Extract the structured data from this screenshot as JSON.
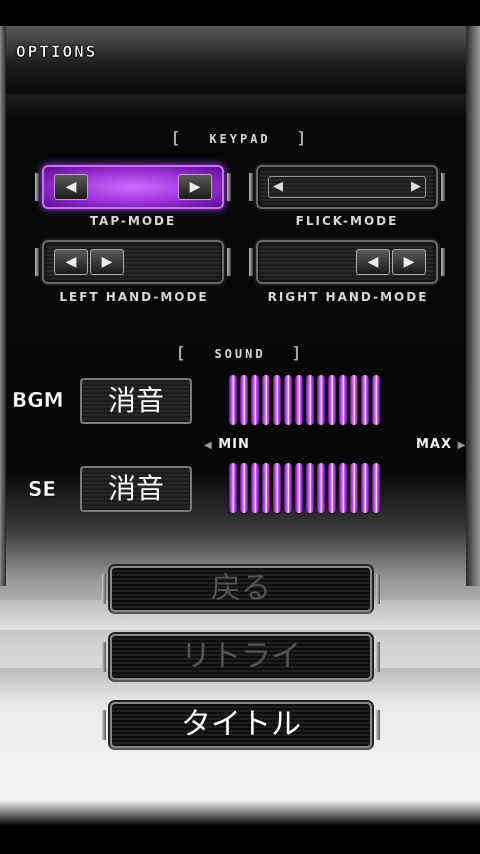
{
  "header": {
    "title": "OPTIONS"
  },
  "keypad": {
    "section_label": "KEYPAD",
    "bracket_open": "[",
    "bracket_close": "]",
    "modes": [
      {
        "label": "TAP-MODE",
        "selected": true
      },
      {
        "label": "FLICK-MODE",
        "selected": false
      },
      {
        "label": "LEFT HAND-MODE",
        "selected": false
      },
      {
        "label": "RIGHT HAND-MODE",
        "selected": false
      }
    ],
    "arrow_left": "◀",
    "arrow_right": "▶"
  },
  "sound": {
    "section_label": "SOUND",
    "bgm": {
      "label": "BGM",
      "mute_label": "消音",
      "level": 14,
      "max_level": 14
    },
    "se": {
      "label": "SE",
      "mute_label": "消音",
      "level": 14,
      "max_level": 14
    },
    "min_label": "MIN",
    "max_label": "MAX"
  },
  "buttons": {
    "back": {
      "label": "戻る",
      "enabled": false
    },
    "retry": {
      "label": "リトライ",
      "enabled": false
    },
    "title": {
      "label": "タイトル",
      "enabled": true
    }
  },
  "colors": {
    "accent_purple": "#b040ff"
  }
}
